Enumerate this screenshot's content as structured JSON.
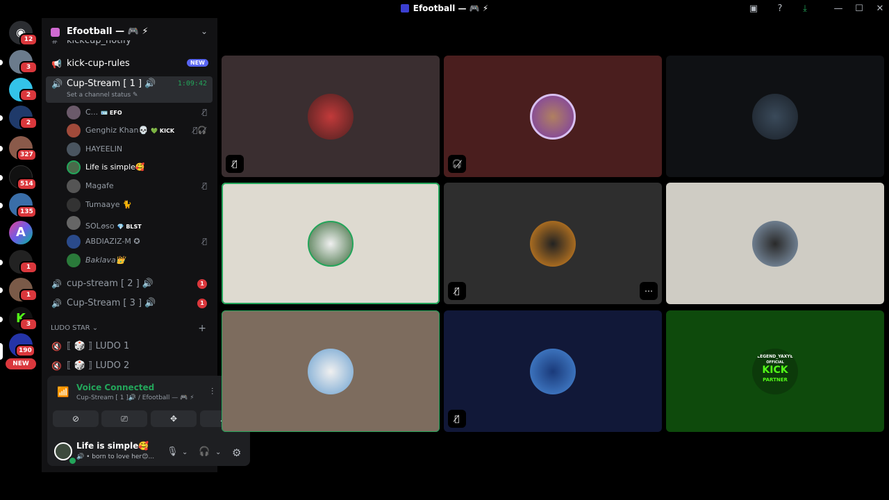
{
  "window": {
    "title": "Efootball — 🎮 ⚡"
  },
  "rail": {
    "badges": [
      "12",
      "3",
      "2",
      "2",
      "327",
      "514",
      "135",
      "1",
      "1",
      "3",
      "190"
    ],
    "new_label": "NEW"
  },
  "server": {
    "name": "Efootball — 🎮 ⚡"
  },
  "channels": {
    "partial_top": "kickcup_notify",
    "rules": {
      "label": "kick-cup-rules",
      "badge": "NEW"
    },
    "active": {
      "label": "Cup-Stream [ 1 ] 🔊",
      "timer": "1:09:42",
      "status": "Set a channel status ✎"
    },
    "stream2": {
      "label": "cup-stream [ 2 ] 🔊",
      "badge": "1"
    },
    "stream3": {
      "label": "Cup-Stream [ 3 ] 🔊",
      "badge": "1"
    },
    "category": "LUDO STAR ⌄",
    "ludo1": "⟦ 🎲 ⟧ LUDO 1",
    "ludo2": "⟦ 🎲 ⟧ LUDO 2"
  },
  "members": [
    {
      "name": "C...",
      "tag": "🪪 EFO"
    },
    {
      "name": "Genghiz Khan💀",
      "tag": "💚 KICK"
    },
    {
      "name": "HAYEELIN",
      "tag": ""
    },
    {
      "name": "Life is simple🥰",
      "tag": ""
    },
    {
      "name": "Magafe",
      "tag": ""
    },
    {
      "name": "Tumaaye 🐈",
      "tag": ""
    },
    {
      "name": "SOLꪮso",
      "tag": "💎 BLST"
    },
    {
      "name": "ABDIAZIZ-M ✪",
      "tag": ""
    },
    {
      "name": "Baklava👑",
      "tag": ""
    }
  ],
  "voice_panel": {
    "title": "Voice Connected",
    "subtitle": "Cup-Stream [ 1 ]🔊 / Efootball — 🎮 ⚡"
  },
  "user": {
    "name": "Life is simple🥰",
    "status": "🔊 • born to love her😊..."
  },
  "tiles": {
    "kick_top": "LEGEND_YAXYE",
    "kick_mid": "OFFICIAL",
    "kick_main": "KICK",
    "kick_sub": "PARTNER"
  }
}
